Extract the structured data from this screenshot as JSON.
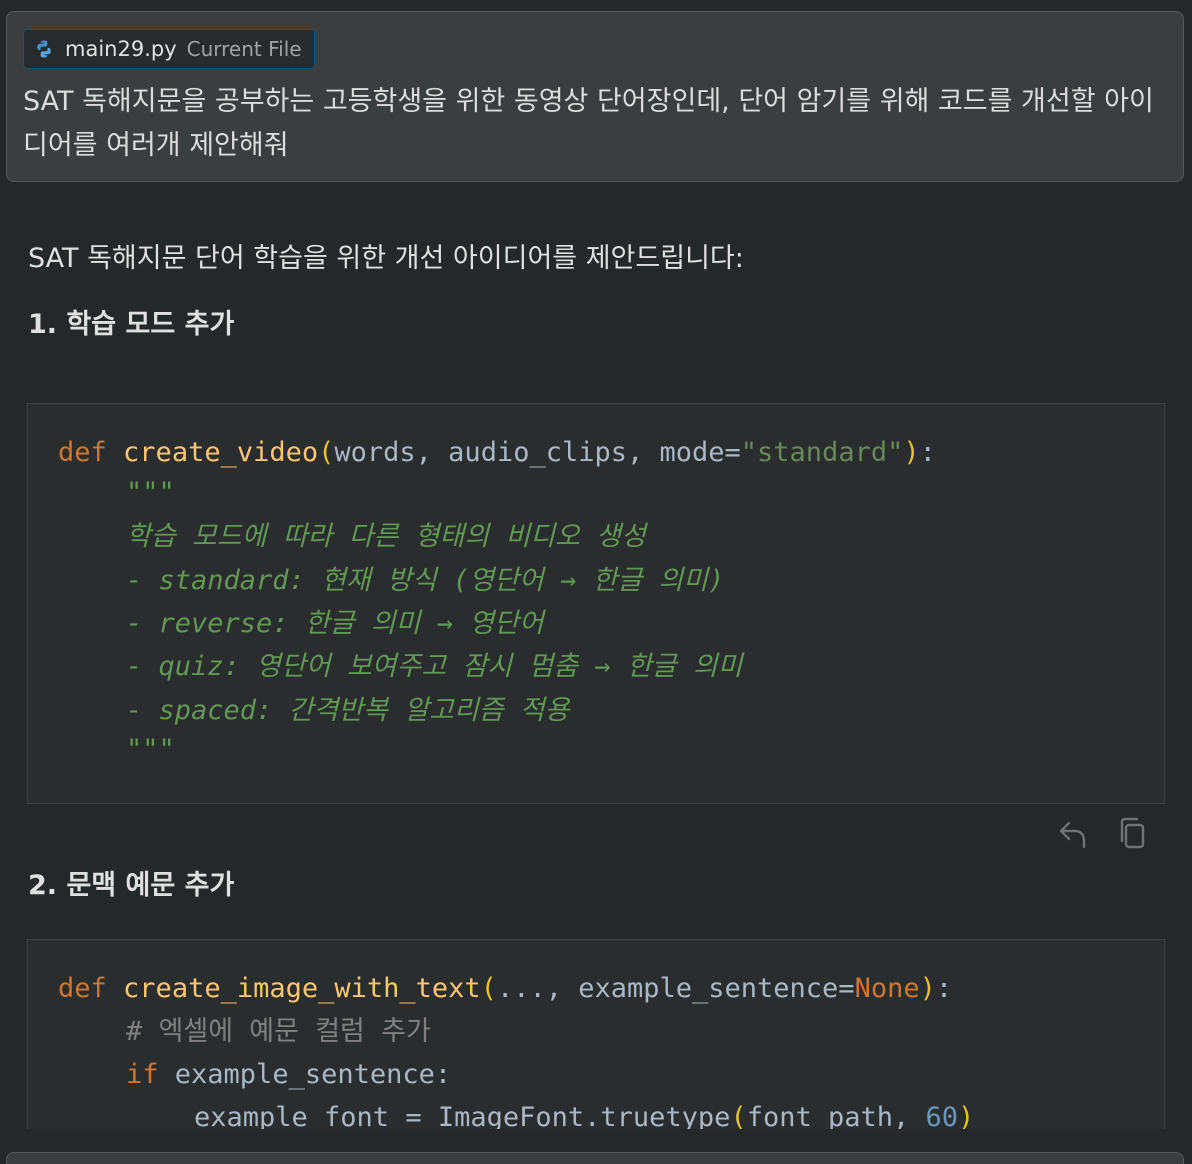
{
  "prompt": {
    "file_chip": {
      "filename": "main29.py",
      "tag": "Current File",
      "icon": "python-icon"
    },
    "message": "SAT 독해지문을 공부하는 고등학생을 위한 동영상 단어장인데, 단어 암기를 위해 코드를 개선할 아이디어를 여러개 제안해줘"
  },
  "response": {
    "intro": "SAT 독해지문 단어 학습을 위한 개선 아이디어를 제안드립니다:",
    "sections": [
      {
        "heading": "1. 학습 모드 추가",
        "code": {
          "l1": {
            "kw": "def",
            "fn": "create_video",
            "open": "(",
            "args": "words, audio_clips, mode=",
            "str": "\"standard\"",
            "close": ")",
            "tail": ":"
          },
          "doc": [
            "\"\"\"",
            "학습 모드에 따라 다른 형태의 비디오 생성",
            "- standard: 현재 방식 (영단어 → 한글 의미)",
            "- reverse: 한글 의미 → 영단어",
            "- quiz: 영단어 보여주고 잠시 멈춤 → 한글 의미",
            "- spaced: 간격반복 알고리즘 적용",
            "\"\"\""
          ]
        },
        "actions": {
          "apply_icon": "reply-arrow-icon",
          "copy_icon": "copy-icon"
        }
      },
      {
        "heading": "2. 문맥 예문 추가",
        "code": {
          "l1": {
            "kw": "def",
            "fn": "create_image_with_text",
            "open": "(",
            "args": "..., example_sentence=",
            "none": "None",
            "close": ")",
            "tail": ":"
          },
          "l2": "# 엑셀에 예문 컬럼 추가",
          "l3": {
            "kw": "if",
            "rest": "example_sentence:"
          },
          "l4": {
            "pre": "example_font = ImageFont.truetype",
            "open": "(",
            "args": "font_path, ",
            "num": "60",
            "close": ")"
          }
        }
      }
    ]
  },
  "colors": {
    "background": "#252828",
    "keyword": "#cc7832",
    "function": "#ffc66d",
    "string": "#6a8759",
    "docstring": "#629755",
    "comment": "#808080",
    "number": "#6897bb"
  }
}
